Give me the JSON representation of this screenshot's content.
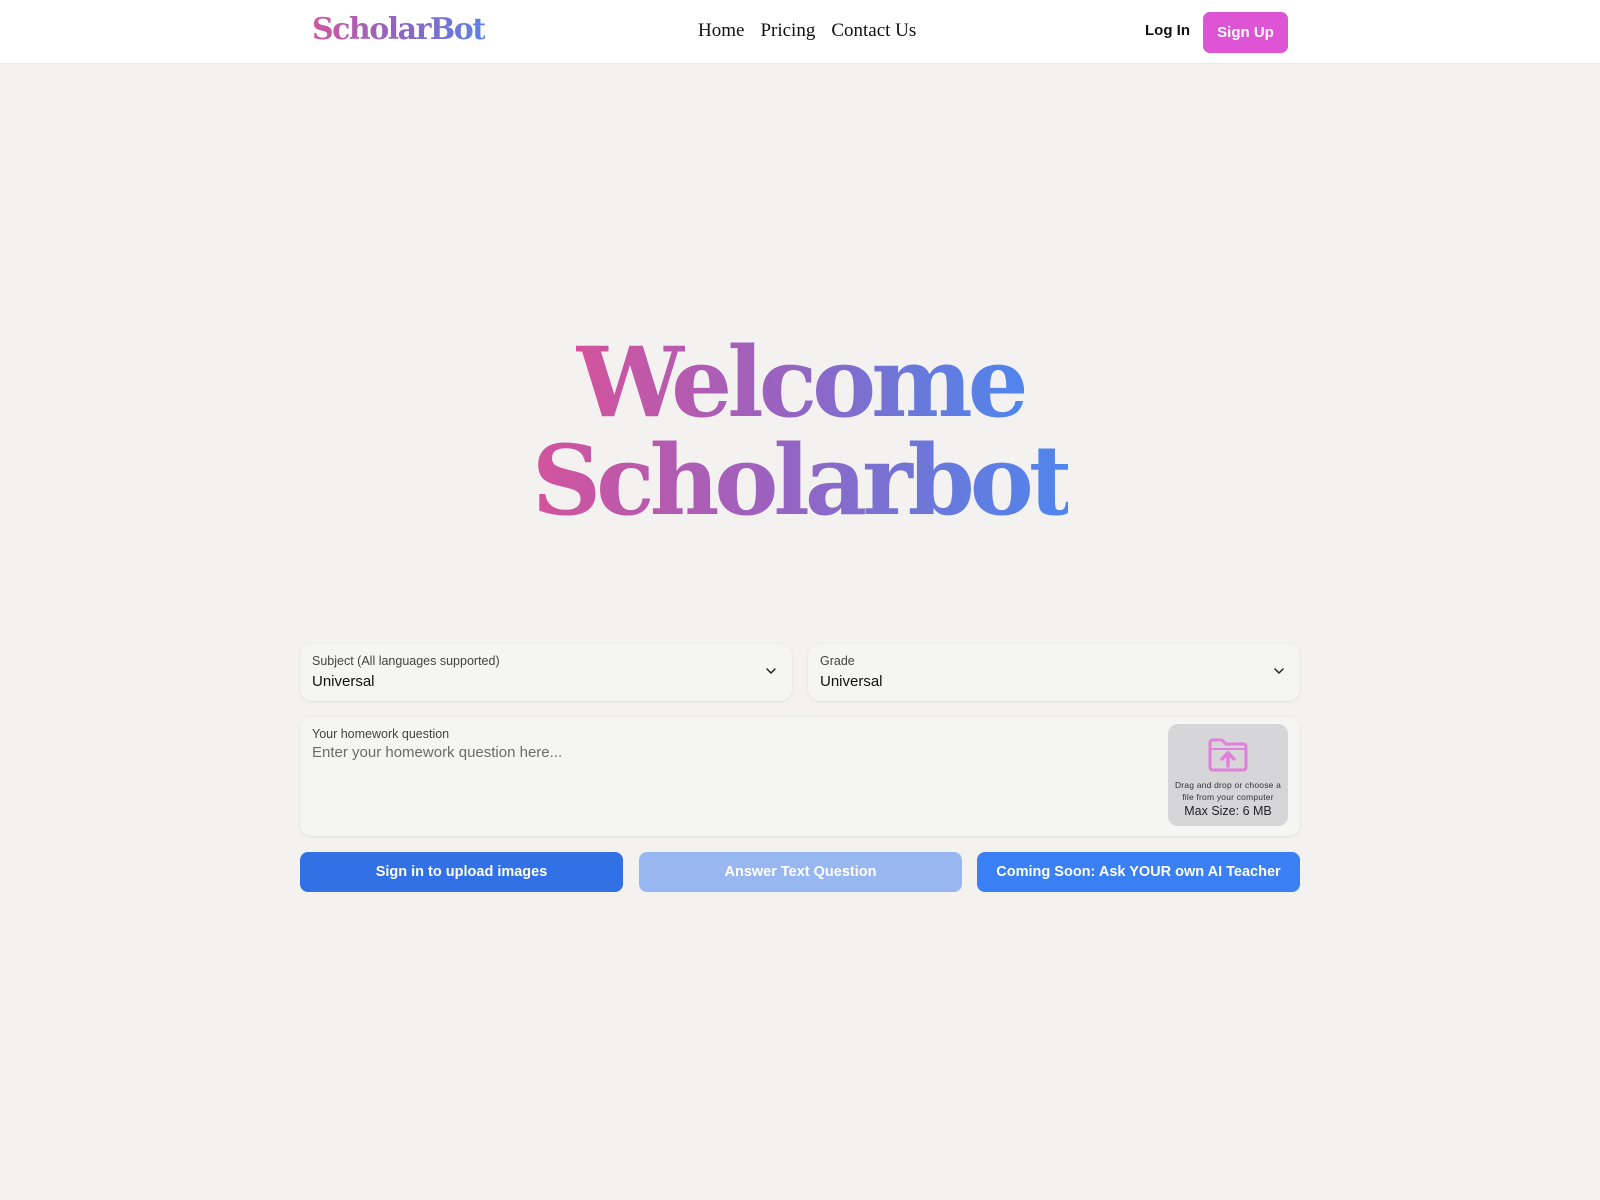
{
  "header": {
    "logo": "ScholarBot",
    "nav": [
      "Home",
      "Pricing",
      "Contact Us"
    ],
    "login_label": "Log In",
    "signup_label": "Sign Up"
  },
  "hero": {
    "line1": "Welcome",
    "line2": "Scholarbot"
  },
  "form": {
    "subject": {
      "label": "Subject (All languages supported)",
      "value": "Universal"
    },
    "grade": {
      "label": "Grade",
      "value": "Universal"
    },
    "question": {
      "label": "Your homework question",
      "placeholder": "Enter your homework question here...",
      "value": ""
    },
    "dropzone": {
      "icon": "folder-upload-icon",
      "text": "Drag and drop or choose a file from your computer",
      "max_size": "Max Size: 6 MB"
    }
  },
  "actions": {
    "upload_label": "Sign in to upload images",
    "answer_label": "Answer Text Question",
    "teacher_label": "Coming Soon: Ask YOUR own AI Teacher"
  },
  "colors": {
    "brand_pink": "#dd54d5",
    "primary_blue": "#3270e6",
    "disabled_blue": "#98b7f1",
    "accent_blue": "#3a80f4",
    "background": "#f3f2f1"
  }
}
